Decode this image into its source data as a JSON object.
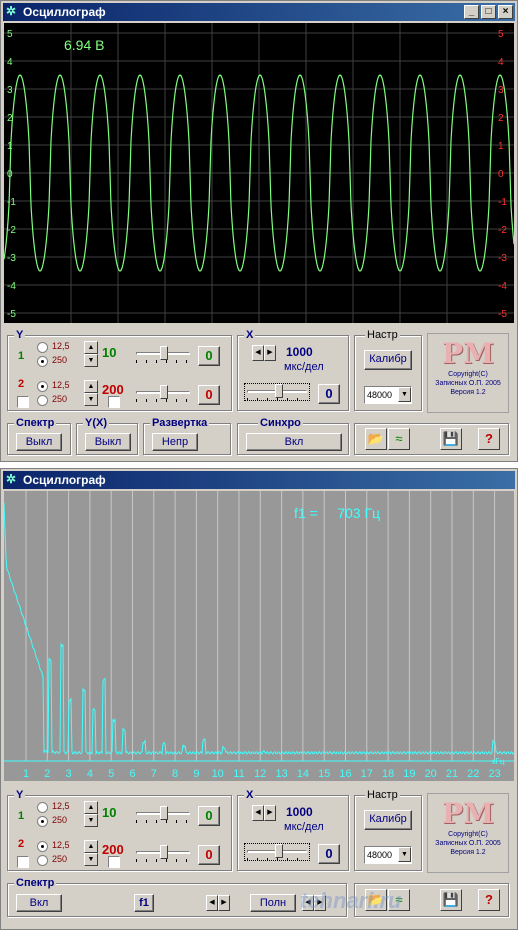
{
  "windows": [
    {
      "title": "Осциллограф",
      "measure_text": "6.94 В",
      "left_axis": [
        "5",
        "4",
        "3",
        "2",
        "1",
        "0",
        "-1",
        "-2",
        "-3",
        "-4",
        "-5"
      ],
      "right_axis": [
        "5",
        "4",
        "3",
        "2",
        "1",
        "0",
        "-1",
        "-2",
        "-3",
        "-4",
        "-5"
      ]
    },
    {
      "title": "Осциллограф",
      "measure_text": "f1 =     703 Гц",
      "x_axis": [
        "1",
        "2",
        "3",
        "4",
        "5",
        "6",
        "7",
        "8",
        "9",
        "10",
        "11",
        "12",
        "13",
        "14",
        "15",
        "16",
        "17",
        "18",
        "19",
        "20",
        "21",
        "22",
        "23"
      ],
      "ktc_label": "кГц"
    }
  ],
  "controls": {
    "y_label": "Y",
    "ch1_label": "1",
    "ch2_label": "2",
    "range_125": "12,5",
    "range_250": "250",
    "ch1_value": "10",
    "ch2_value": "200",
    "ch1_offset": "0",
    "ch2_offset": "0",
    "x_label": "X",
    "x_value": "1000",
    "x_unit": "мкс/дел",
    "x_offset": "0",
    "nastr_label": "Настр",
    "calib_button": "Калибр",
    "rate": "48000",
    "copyright_line1": "Copyright(C)",
    "copyright_line2": "Записных О.П. 2005",
    "copyright_line3": "Версия 1.2",
    "logo_text": "PM",
    "spectr_label": "Спектр",
    "spectr_off": "Выкл",
    "spectr_on": "Вкл",
    "yx_label": "Y(X)",
    "yx_off": "Выкл",
    "razv_label": "Развертка",
    "razv_btn": "Непр",
    "sync_label": "Синхро",
    "sync_btn": "Вкл",
    "f1_btn": "f1",
    "full_btn": "Полн",
    "help": "?"
  },
  "colors": {
    "trace": "#7fff7f",
    "spectrum": "#40ffff",
    "title_bar": "#0a246a",
    "ch1": "#008000",
    "ch2": "#c00000"
  },
  "watermark": "tehnari.ru"
}
